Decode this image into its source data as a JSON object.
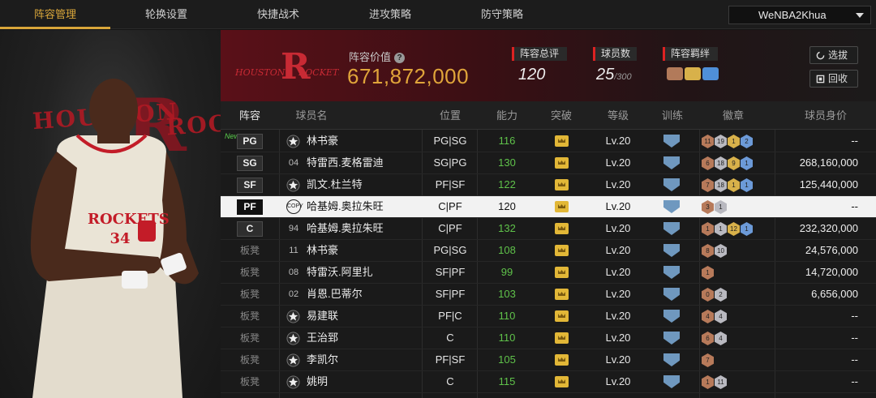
{
  "nav": {
    "tabs": [
      "阵容管理",
      "轮换设置",
      "快捷战术",
      "进攻策略",
      "防守策略"
    ],
    "active_tab": "阵容管理",
    "account": "WeNBA2Khua"
  },
  "player_art": {
    "banner_left": "HOUSTON",
    "banner_right": "ROCK",
    "jersey": "ROCKETS 34"
  },
  "header": {
    "team_logo_text": "HOUSTON ROCKETS",
    "value_label": "阵容价值",
    "value": "671,872,000",
    "overall_label": "阵容总评",
    "overall_value": "120",
    "count_label": "球员数",
    "count_value": "25",
    "count_max": "/300",
    "bond_label": "阵容羁绊",
    "btn_select": "选拔",
    "btn_recycle": "回收",
    "accent_gold": "#e0a53a",
    "accent_red": "#d22222"
  },
  "table": {
    "columns": [
      "阵容",
      "球员名",
      "位置",
      "能力",
      "突破",
      "等级",
      "训练",
      "徽章",
      "球员身价"
    ],
    "rows": [
      {
        "slot": "PG",
        "is_bench": false,
        "new": "New",
        "num": "",
        "star": true,
        "name": "林书豪",
        "position": "PG|SG",
        "ability": "116",
        "level": "Lv.20",
        "badges": [
          {
            "t": "b",
            "v": "11"
          },
          {
            "t": "s",
            "v": "19"
          },
          {
            "t": "g",
            "v": "1"
          },
          {
            "t": "d",
            "v": "2"
          }
        ],
        "value": "--"
      },
      {
        "slot": "SG",
        "is_bench": false,
        "new": "",
        "num": "04",
        "star": false,
        "name": "特雷西.麦格雷迪",
        "position": "SG|PG",
        "ability": "130",
        "level": "Lv.20",
        "badges": [
          {
            "t": "b",
            "v": "6"
          },
          {
            "t": "s",
            "v": "18"
          },
          {
            "t": "g",
            "v": "9"
          },
          {
            "t": "d",
            "v": "1"
          }
        ],
        "value": "268,160,000"
      },
      {
        "slot": "SF",
        "is_bench": false,
        "new": "",
        "num": "",
        "star": true,
        "name": "凯文.杜兰特",
        "position": "PF|SF",
        "ability": "122",
        "level": "Lv.20",
        "badges": [
          {
            "t": "b",
            "v": "7"
          },
          {
            "t": "s",
            "v": "18"
          },
          {
            "t": "g",
            "v": "1"
          },
          {
            "t": "d",
            "v": "1"
          }
        ],
        "value": "125,440,000"
      },
      {
        "slot": "PF",
        "is_bench": false,
        "new": "",
        "num": "COPY",
        "star": false,
        "name": "哈基姆.奥拉朱旺",
        "position": "C|PF",
        "ability": "120",
        "level": "Lv.20",
        "badges": [
          {
            "t": "b",
            "v": "3"
          },
          {
            "t": "s",
            "v": "1"
          }
        ],
        "value": "--",
        "selected": true
      },
      {
        "slot": "C",
        "is_bench": false,
        "new": "",
        "num": "94",
        "star": false,
        "name": "哈基姆.奥拉朱旺",
        "position": "C|PF",
        "ability": "132",
        "level": "Lv.20",
        "badges": [
          {
            "t": "b",
            "v": "1"
          },
          {
            "t": "s",
            "v": "1"
          },
          {
            "t": "g",
            "v": "12"
          },
          {
            "t": "d",
            "v": "1"
          }
        ],
        "value": "232,320,000"
      },
      {
        "slot": "板凳",
        "is_bench": true,
        "new": "",
        "num": "11",
        "star": false,
        "name": "林书豪",
        "position": "PG|SG",
        "ability": "108",
        "level": "Lv.20",
        "badges": [
          {
            "t": "b",
            "v": "8"
          },
          {
            "t": "s",
            "v": "10"
          }
        ],
        "value": "24,576,000"
      },
      {
        "slot": "板凳",
        "is_bench": true,
        "new": "",
        "num": "08",
        "star": false,
        "name": "特雷沃.阿里扎",
        "position": "SF|PF",
        "ability": "99",
        "level": "Lv.20",
        "badges": [
          {
            "t": "b",
            "v": "1"
          }
        ],
        "value": "14,720,000"
      },
      {
        "slot": "板凳",
        "is_bench": true,
        "new": "",
        "num": "02",
        "star": false,
        "name": "肖恩.巴蒂尔",
        "position": "SF|PF",
        "ability": "103",
        "level": "Lv.20",
        "badges": [
          {
            "t": "b",
            "v": "0"
          },
          {
            "t": "s",
            "v": "2"
          }
        ],
        "value": "6,656,000"
      },
      {
        "slot": "板凳",
        "is_bench": true,
        "new": "",
        "num": "",
        "star": true,
        "name": "易建联",
        "position": "PF|C",
        "ability": "110",
        "level": "Lv.20",
        "badges": [
          {
            "t": "b",
            "v": "4"
          },
          {
            "t": "s",
            "v": "4"
          }
        ],
        "value": "--"
      },
      {
        "slot": "板凳",
        "is_bench": true,
        "new": "",
        "num": "",
        "star": true,
        "name": "王治郅",
        "position": "C",
        "ability": "110",
        "level": "Lv.20",
        "badges": [
          {
            "t": "b",
            "v": "6"
          },
          {
            "t": "s",
            "v": "4"
          }
        ],
        "value": "--"
      },
      {
        "slot": "板凳",
        "is_bench": true,
        "new": "",
        "num": "",
        "star": true,
        "name": "李凯尔",
        "position": "PF|SF",
        "ability": "105",
        "level": "Lv.20",
        "badges": [
          {
            "t": "b",
            "v": "7"
          }
        ],
        "value": "--"
      },
      {
        "slot": "板凳",
        "is_bench": true,
        "new": "",
        "num": "",
        "star": true,
        "name": "姚明",
        "position": "C",
        "ability": "115",
        "level": "Lv.20",
        "badges": [
          {
            "t": "b",
            "v": "1"
          },
          {
            "t": "s",
            "v": "11"
          }
        ],
        "value": "--"
      }
    ]
  }
}
